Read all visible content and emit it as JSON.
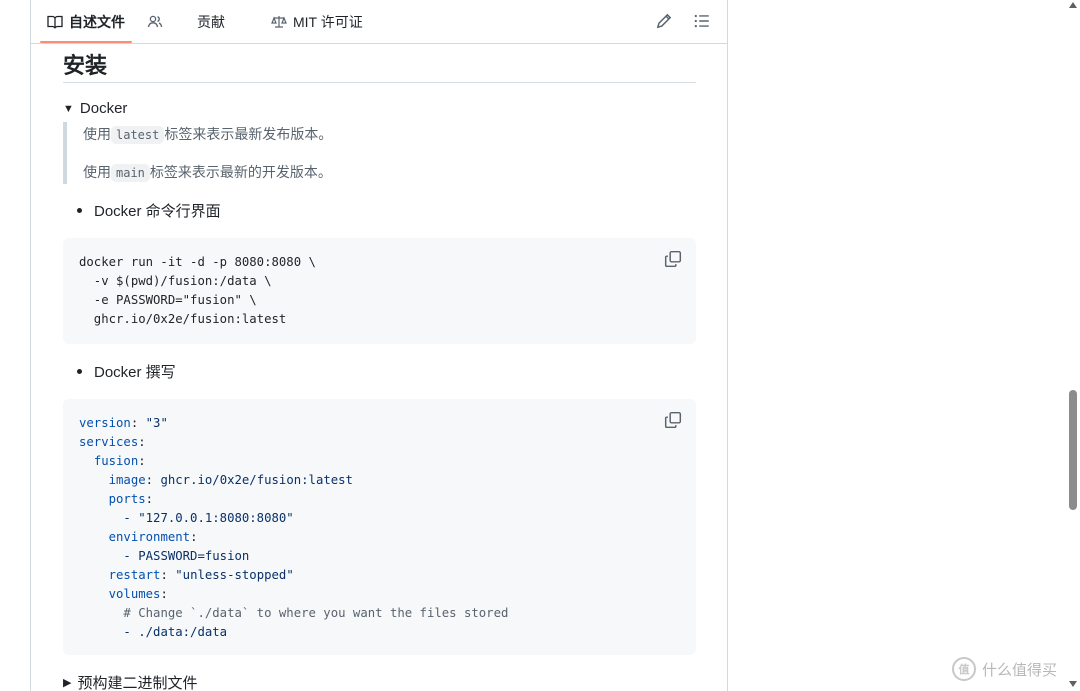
{
  "tabs": {
    "readme": "自述文件",
    "contributors_icon": "people-icon",
    "contributions": "贡献",
    "license": "MIT 许可证"
  },
  "toolbar": {
    "edit_icon": "pencil-icon",
    "outline_icon": "list-icon"
  },
  "section": {
    "title": "安装"
  },
  "docker_details": {
    "summary": "Docker",
    "quote_line1_prefix": "使用",
    "quote_line1_code": "latest",
    "quote_line1_suffix": "标签来表示最新发布版本。",
    "quote_line2_prefix": "使用",
    "quote_line2_code": "main",
    "quote_line2_suffix": "标签来表示最新的开发版本。"
  },
  "cli": {
    "label": "Docker 命令行界面",
    "lines": [
      "docker run -it -d -p 8080:8080 \\",
      "  -v $(pwd)/fusion:/data \\",
      "  -e PASSWORD=\"fusion\" \\",
      "  ghcr.io/0x2e/fusion:latest"
    ]
  },
  "compose": {
    "label": "Docker 撰写",
    "version_key": "version",
    "version_val": "\"3\"",
    "services_key": "services",
    "fusion_key": "fusion",
    "image_key": "image",
    "image_val": "ghcr.io/0x2e/fusion:latest",
    "ports_key": "ports",
    "ports_item": "- \"127.0.0.1:8080:8080\"",
    "env_key": "environment",
    "env_item": "- PASSWORD=fusion",
    "restart_key": "restart",
    "restart_val": "\"unless-stopped\"",
    "volumes_key": "volumes",
    "volumes_comment": "# Change `./data` to where you want the files stored",
    "volumes_item": "- ./data:/data"
  },
  "prebuilt": {
    "summary": "预构建二进制文件"
  },
  "watermark": {
    "text": "什么值得买",
    "badge": "值"
  }
}
